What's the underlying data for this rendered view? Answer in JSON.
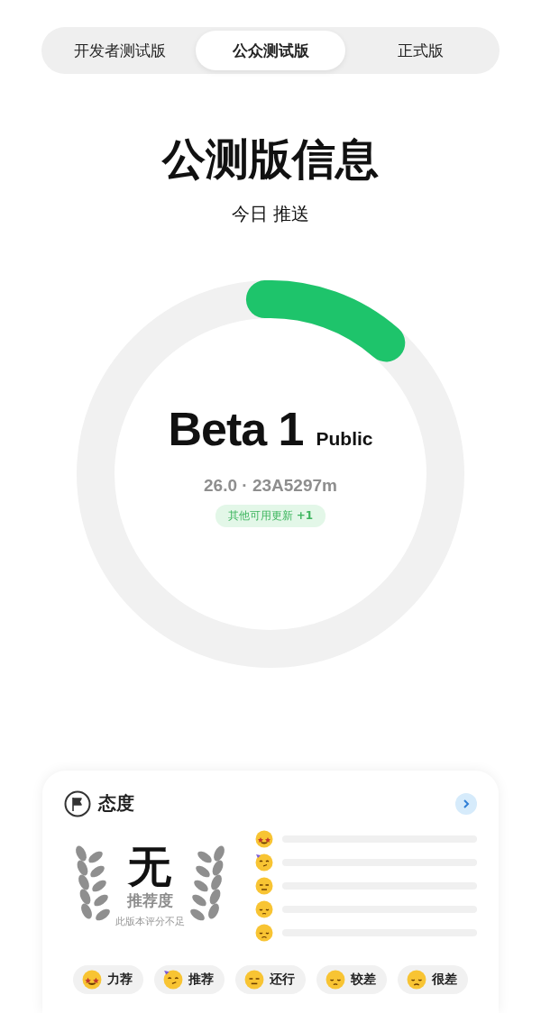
{
  "tabs": [
    {
      "label": "开发者测试版",
      "selected": false
    },
    {
      "label": "公众测试版",
      "selected": true
    },
    {
      "label": "正式版",
      "selected": false
    }
  ],
  "title": "公测版信息",
  "subtitle": "今日 推送",
  "release": {
    "level": 0.12,
    "name": "Beta 1",
    "channel": "Public",
    "build": "26.0 · 23A5297m",
    "badge": "其他可用更新 **+1**"
  },
  "attitude": {
    "title": "态度",
    "score": "无",
    "score_label": "推荐度",
    "note": "此版本评分不足",
    "ratings": [
      {
        "kind": "starstruck"
      },
      {
        "kind": "party"
      },
      {
        "kind": "neutral"
      },
      {
        "kind": "pensive"
      },
      {
        "kind": "sad"
      }
    ],
    "votes": [
      {
        "kind": "starstruck",
        "label": "力荐"
      },
      {
        "kind": "party",
        "label": "推荐"
      },
      {
        "kind": "neutral",
        "label": "还行"
      },
      {
        "kind": "pensive",
        "label": "较差"
      },
      {
        "kind": "sad",
        "label": "很差"
      }
    ]
  }
}
